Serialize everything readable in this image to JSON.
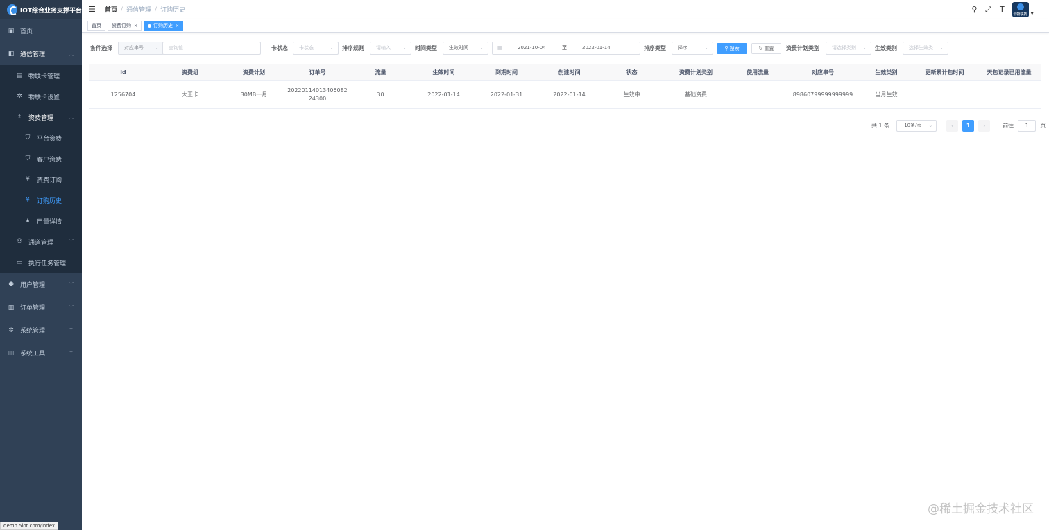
{
  "app": {
    "title": "IOT综合业务支撑平台"
  },
  "sidebar": {
    "items": [
      {
        "label": "首页",
        "icon": "dashboard-icon"
      },
      {
        "label": "通信管理",
        "icon": "communication-icon"
      },
      {
        "label": "物联卡管理",
        "icon": "card-icon"
      },
      {
        "label": "物联卡设置",
        "icon": "gear-icon"
      },
      {
        "label": "资费管理",
        "icon": "tariff-icon"
      },
      {
        "label": "平台资费",
        "icon": "shield-icon"
      },
      {
        "label": "客户资费",
        "icon": "shield-check-icon"
      },
      {
        "label": "资费订购",
        "icon": "yen-icon"
      },
      {
        "label": "订购历史",
        "icon": "yen-icon"
      },
      {
        "label": "用量详情",
        "icon": "star-icon"
      },
      {
        "label": "通道管理",
        "icon": "tree-icon"
      },
      {
        "label": "执行任务管理",
        "icon": "monitor-icon"
      },
      {
        "label": "用户管理",
        "icon": "user-icon"
      },
      {
        "label": "订单管理",
        "icon": "chart-icon"
      },
      {
        "label": "系统管理",
        "icon": "gear-icon"
      },
      {
        "label": "系统工具",
        "icon": "toolbox-icon"
      }
    ]
  },
  "status_url": "demo.5iot.com/index",
  "breadcrumb": {
    "home": "首页",
    "mid": "通信管理",
    "last": "订购历史",
    "sep": "/"
  },
  "tags": [
    {
      "label": "首页"
    },
    {
      "label": "资费订购"
    },
    {
      "label": "订购历史"
    }
  ],
  "avatar_text": "云物联技",
  "filters": {
    "condition_label": "条件选择",
    "condition_select": "对应串号",
    "condition_input_placeholder": "查询值",
    "card_status_label": "卡状态",
    "card_status_placeholder": "卡状态",
    "sort_rule_label": "排序规则",
    "sort_rule_placeholder": "请输入",
    "time_type_label": "时间类型",
    "time_type_value": "生效时间",
    "date_start": "2021-10-04",
    "date_sep": "至",
    "date_end": "2022-01-14",
    "sort_type_label": "排序类型",
    "sort_type_value": "降序",
    "search_button": "搜索",
    "reset_button": "重置",
    "plan_type_label": "资费计划类别",
    "plan_type_placeholder": "请选择类别",
    "effect_type_label": "生效类别",
    "effect_type_placeholder": "选择生效类"
  },
  "table": {
    "columns": [
      "id",
      "资费组",
      "资费计划",
      "订单号",
      "流量",
      "生效时间",
      "到期时间",
      "创建时间",
      "状态",
      "资费计划类别",
      "使用流量",
      "对应串号",
      "生效类别",
      "更新累计包时间",
      "天包记录已用流量"
    ],
    "rows": [
      [
        "1256704",
        "大王卡",
        "30MB一月",
        "2022011401340608224300",
        "30",
        "2022-01-14",
        "2022-01-31",
        "2022-01-14",
        "生效中",
        "基础资费",
        "",
        "89860799999999999",
        "当月生效",
        "",
        ""
      ]
    ]
  },
  "pagination": {
    "total": "共 1 条",
    "page_size": "10条/页",
    "prev": "‹",
    "current": "1",
    "next": "›",
    "goto_label": "前往",
    "goto_value": "1",
    "page_suffix": "页"
  },
  "watermark": "@稀土掘金技术社区",
  "colors": {
    "sidebar_bg": "#304156",
    "primary": "#409eff",
    "active_menu": "#409eff"
  }
}
